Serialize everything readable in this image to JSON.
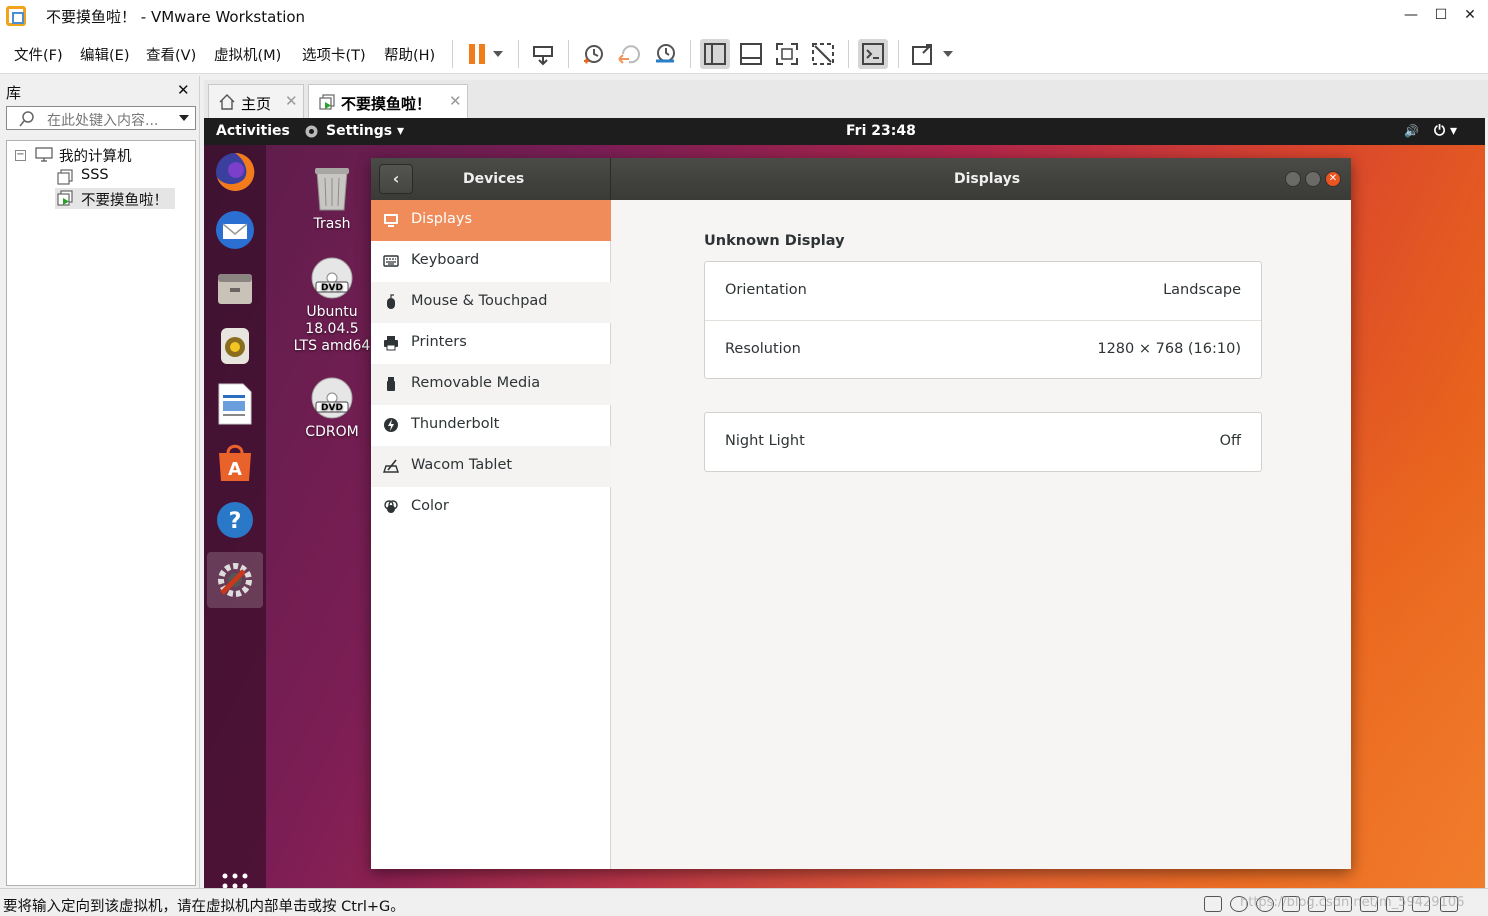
{
  "window": {
    "title": "不要摸鱼啦！ - VMware Workstation",
    "minimize": "—",
    "maximize": "☐",
    "close": "✕"
  },
  "menu": [
    "文件(F)",
    "编辑(E)",
    "查看(V)",
    "虚拟机(M)",
    "选项卡(T)",
    "帮助(H)"
  ],
  "toolbar": {
    "icons": [
      "pause-icon",
      "dropdown-arrow-icon",
      "send-ctrl-alt-del-icon",
      "snapshot-icon",
      "revert-snapshot-icon",
      "snapshot-manager-icon",
      "show-library-icon",
      "thumbnail-bar-icon",
      "full-screen-icon",
      "unity-icon",
      "console-view-icon",
      "stretch-guest-icon",
      "dropdown-arrow-icon"
    ],
    "pause_color": "#f07d1a"
  },
  "library": {
    "title": "库",
    "close": "✕",
    "search_placeholder": "在此处键入内容...",
    "tree": {
      "root": "我的计算机",
      "expander": "−",
      "children": [
        "SSS",
        "不要摸鱼啦！"
      ],
      "selected": "不要摸鱼啦！"
    }
  },
  "tabs": [
    {
      "label": "主页",
      "close": "✕",
      "icon": "home-icon"
    },
    {
      "label": "不要摸鱼啦！",
      "close": "✕",
      "icon": "vm-icon",
      "active": true
    }
  ],
  "guest": {
    "topbar": {
      "activities": "Activities",
      "app_menu": "Settings ▾",
      "clock": "Fri 23:48",
      "volume": "🔊",
      "power": "⏻ ▾"
    },
    "dock": [
      "firefox-icon",
      "thunderbird-icon",
      "files-icon",
      "rhythmbox-icon",
      "libreoffice-writer-icon",
      "ubuntu-software-icon",
      "help-icon",
      "settings-icon"
    ],
    "desktop_icons": [
      {
        "label": "Trash",
        "icon": "trash-icon"
      },
      {
        "label": "Ubuntu 18.04.5 LTS amd64",
        "icon": "dvd-icon"
      },
      {
        "label": "CDROM",
        "icon": "dvd-icon"
      }
    ],
    "settings": {
      "header_left": "Devices",
      "header_right": "Displays",
      "back": "‹",
      "sidebar": [
        {
          "label": "Displays",
          "icon": "display-icon",
          "active": true
        },
        {
          "label": "Keyboard",
          "icon": "keyboard-icon"
        },
        {
          "label": "Mouse & Touchpad",
          "icon": "mouse-icon"
        },
        {
          "label": "Printers",
          "icon": "printer-icon"
        },
        {
          "label": "Removable Media",
          "icon": "usb-icon"
        },
        {
          "label": "Thunderbolt",
          "icon": "thunderbolt-icon"
        },
        {
          "label": "Wacom Tablet",
          "icon": "tablet-icon"
        },
        {
          "label": "Color",
          "icon": "color-icon"
        }
      ],
      "section_title": "Unknown Display",
      "card1": [
        {
          "label": "Orientation",
          "value": "Landscape"
        },
        {
          "label": "Resolution",
          "value": "1280 × 768 (16:10)"
        }
      ],
      "card2": [
        {
          "label": "Night Light",
          "value": "Off"
        }
      ],
      "accent": "#e95420",
      "selected_bg": "#f08c5a"
    }
  },
  "statusbar": {
    "text": "要将输入定向到该虚拟机，请在虚拟机内部单击或按 Ctrl+G。",
    "watermark": "https://blog.csdn.net/m_59429106"
  }
}
